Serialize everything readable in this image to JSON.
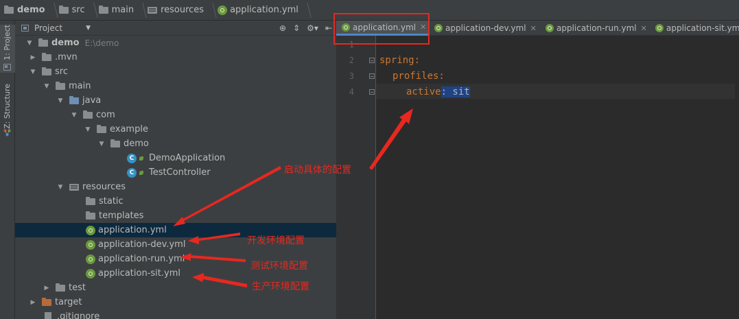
{
  "breadcrumb": [
    {
      "label": "demo",
      "icon": "folder-icon"
    },
    {
      "label": "src",
      "icon": "folder-icon"
    },
    {
      "label": "main",
      "icon": "folder-icon"
    },
    {
      "label": "resources",
      "icon": "resources-folder-icon"
    },
    {
      "label": "application.yml",
      "icon": "yaml-file-icon"
    }
  ],
  "stripe": {
    "project_tab": "1: Project",
    "structure_tab": "Z: Structure"
  },
  "project_panel": {
    "title": "Project"
  },
  "tree": [
    {
      "label": "demo",
      "hint": "E:\\demo",
      "icon": "folder-icon"
    },
    {
      "label": ".mvn",
      "icon": "folder-icon"
    },
    {
      "label": "src",
      "icon": "folder-icon"
    },
    {
      "label": "main",
      "icon": "folder-icon"
    },
    {
      "label": "java",
      "icon": "source-folder-icon"
    },
    {
      "label": "com",
      "icon": "package-icon"
    },
    {
      "label": "example",
      "icon": "package-icon"
    },
    {
      "label": "demo",
      "icon": "package-icon"
    },
    {
      "label": "DemoApplication",
      "icon": "spring-class-icon"
    },
    {
      "label": "TestController",
      "icon": "class-icon"
    },
    {
      "label": "resources",
      "icon": "resources-folder-icon"
    },
    {
      "label": "static",
      "icon": "folder-icon"
    },
    {
      "label": "templates",
      "icon": "folder-icon"
    },
    {
      "label": "application.yml",
      "icon": "yaml-file-icon"
    },
    {
      "label": "application-dev.yml",
      "icon": "yaml-file-icon"
    },
    {
      "label": "application-run.yml",
      "icon": "yaml-file-icon"
    },
    {
      "label": "application-sit.yml",
      "icon": "yaml-file-icon"
    },
    {
      "label": "test",
      "icon": "folder-icon"
    },
    {
      "label": "target",
      "icon": "excluded-folder-icon"
    },
    {
      "label": ".gitignore",
      "icon": "file-icon"
    }
  ],
  "editor_tabs": [
    {
      "label": "application.yml",
      "active": true
    },
    {
      "label": "application-dev.yml",
      "active": false
    },
    {
      "label": "application-run.yml",
      "active": false
    },
    {
      "label": "application-sit.yml",
      "active": false
    }
  ],
  "line_numbers": [
    "1",
    "2",
    "3",
    "4"
  ],
  "code": {
    "line2_key": "spring:",
    "line3_key": "profiles:",
    "line4_key": "active",
    "line4_value": ": sit"
  },
  "annotations": {
    "enable_config": "启动具体的配置",
    "dev_config": "开发环境配置",
    "test_config": "测试环境配置",
    "prod_config": "生产环境配置"
  },
  "colors": {
    "annotation_red": "#e8281f",
    "selection": "#0d293e",
    "keyword": "#cc7832"
  }
}
